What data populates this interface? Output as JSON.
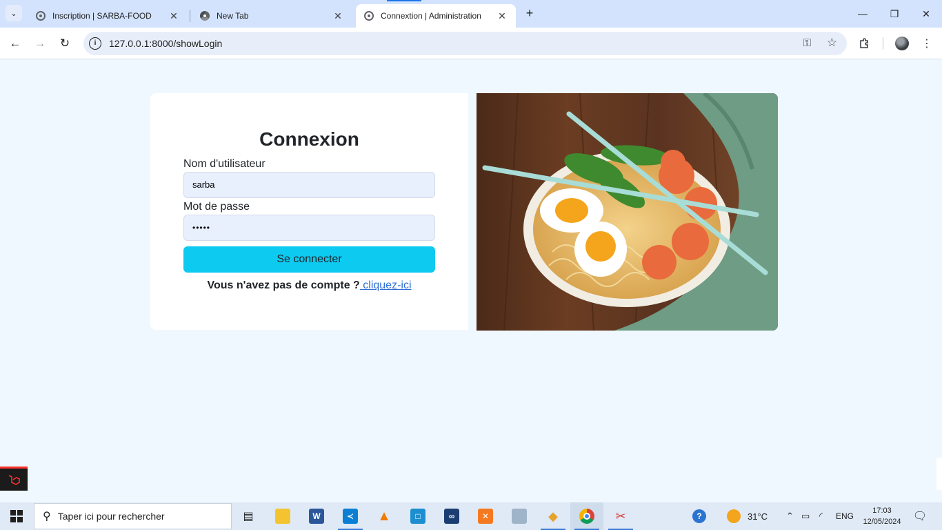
{
  "browser": {
    "tabs": [
      {
        "title": "Inscription | SARBA-FOOD",
        "favicon": "globe-icon",
        "active": false
      },
      {
        "title": "New Tab",
        "favicon": "chrome-icon",
        "active": false
      },
      {
        "title": "Connextion | Administration",
        "favicon": "globe-icon",
        "active": true
      }
    ],
    "address": "127.0.0.1:8000/showLogin"
  },
  "login": {
    "title": "Connexion",
    "username_label": "Nom d'utilisateur",
    "username_value": "sarba",
    "password_label": "Mot de passe",
    "password_value": "•••••",
    "submit_label": "Se connecter",
    "signup_prompt": "Vous n'avez pas de compte ?",
    "signup_link": " cliquez-ici"
  },
  "taskbar": {
    "search_placeholder": "Taper ici pour rechercher",
    "weather": "31°C",
    "language": "ENG",
    "time": "17:03",
    "date": "12/05/2024"
  },
  "colors": {
    "page_background": "#f0f8ff",
    "button_accent": "#0dcaf0",
    "link": "#2f6fd6",
    "tab_strip": "#d3e3fd"
  }
}
